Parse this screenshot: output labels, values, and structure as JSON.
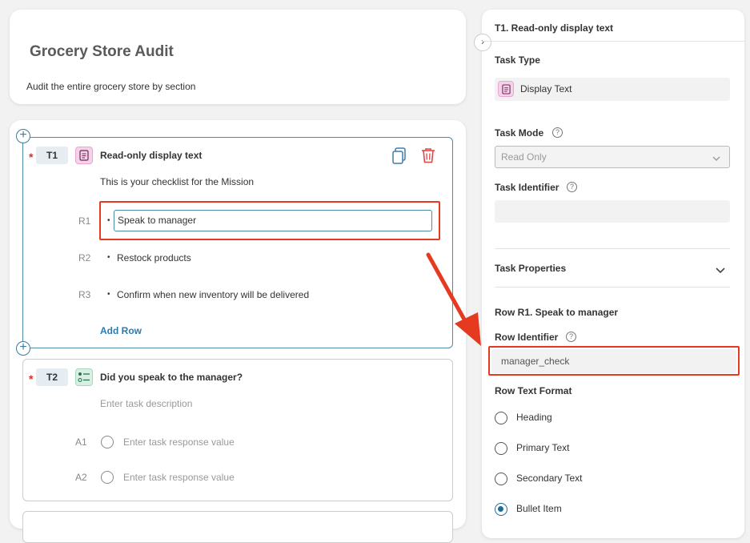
{
  "header": {
    "title": "Grocery Store Audit",
    "description": "Audit the entire grocery store by section"
  },
  "task1": {
    "required_marker": "*",
    "id": "T1",
    "icon": "document-icon",
    "title": "Read-only display text",
    "description": "This is your checklist for the Mission",
    "rows": [
      {
        "label": "R1",
        "bullet": "•",
        "text": "Speak to manager"
      },
      {
        "label": "R2",
        "bullet": "•",
        "text": "Restock products"
      },
      {
        "label": "R3",
        "bullet": "•",
        "text": "Confirm when new inventory will be delivered"
      }
    ],
    "add_row_label": "Add Row"
  },
  "task2": {
    "required_marker": "*",
    "id": "T2",
    "icon": "choice-list-icon",
    "title": "Did you speak to the manager?",
    "description_placeholder": "Enter task description",
    "answers": [
      {
        "label": "A1",
        "placeholder": "Enter task response value"
      },
      {
        "label": "A2",
        "placeholder": "Enter task response value"
      }
    ]
  },
  "panel": {
    "header": "T1. Read-only display text",
    "task_type_label": "Task Type",
    "task_type_value": "Display Text",
    "task_mode_label": "Task Mode",
    "task_mode_value": "Read Only",
    "task_identifier_label": "Task Identifier",
    "task_identifier_value": "",
    "task_properties_label": "Task Properties",
    "row_section_title": "Row R1. Speak to manager",
    "row_identifier_label": "Row Identifier",
    "row_identifier_value": "manager_check",
    "row_text_format_label": "Row Text Format",
    "formats": [
      {
        "label": "Heading",
        "selected": false
      },
      {
        "label": "Primary Text",
        "selected": false
      },
      {
        "label": "Secondary Text",
        "selected": false
      },
      {
        "label": "Bullet Item",
        "selected": true
      }
    ],
    "help_glyph": "?"
  },
  "colors": {
    "accent": "#2a7ab0",
    "required": "#d9302c",
    "annotation": "#e53a1f"
  }
}
